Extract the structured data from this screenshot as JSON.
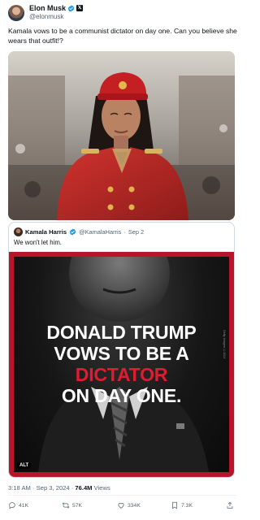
{
  "author": {
    "display_name": "Elon Musk",
    "handle": "@elonmusk"
  },
  "tweet": {
    "text": "Kamala vows to be a communist dictator on day one. Can you believe she wears that outfit!?"
  },
  "quote": {
    "display_name": "Kamala Harris",
    "handle": "@KamalaHarris",
    "date": "Sep 2",
    "separator": "·",
    "text": "We won't let him.",
    "image": {
      "line1": "DONALD TRUMP",
      "line2": "VOWS TO BE A",
      "line3": "DICTATOR",
      "line4": "ON DAY ONE.",
      "alt_badge": "ALT",
      "credit": "Getty Images/ ©2024"
    }
  },
  "meta": {
    "time": "3:18 AM",
    "separator": "·",
    "date": "Sep 3, 2024",
    "views": "76.4M",
    "views_label": "Views"
  },
  "actions": {
    "replies": "41K",
    "reposts": "57K",
    "likes": "334K",
    "bookmarks": "7.3K"
  },
  "colors": {
    "verified": "#1d9bf0",
    "text": "#0f1419",
    "secondary": "#536471",
    "quote_frame": "#b8152a",
    "dictator_red": "#e21c2f"
  },
  "icons": [
    "verified-badge-icon",
    "x-logo-badge-icon",
    "reply-icon",
    "repost-icon",
    "like-icon",
    "bookmark-icon",
    "share-icon"
  ]
}
